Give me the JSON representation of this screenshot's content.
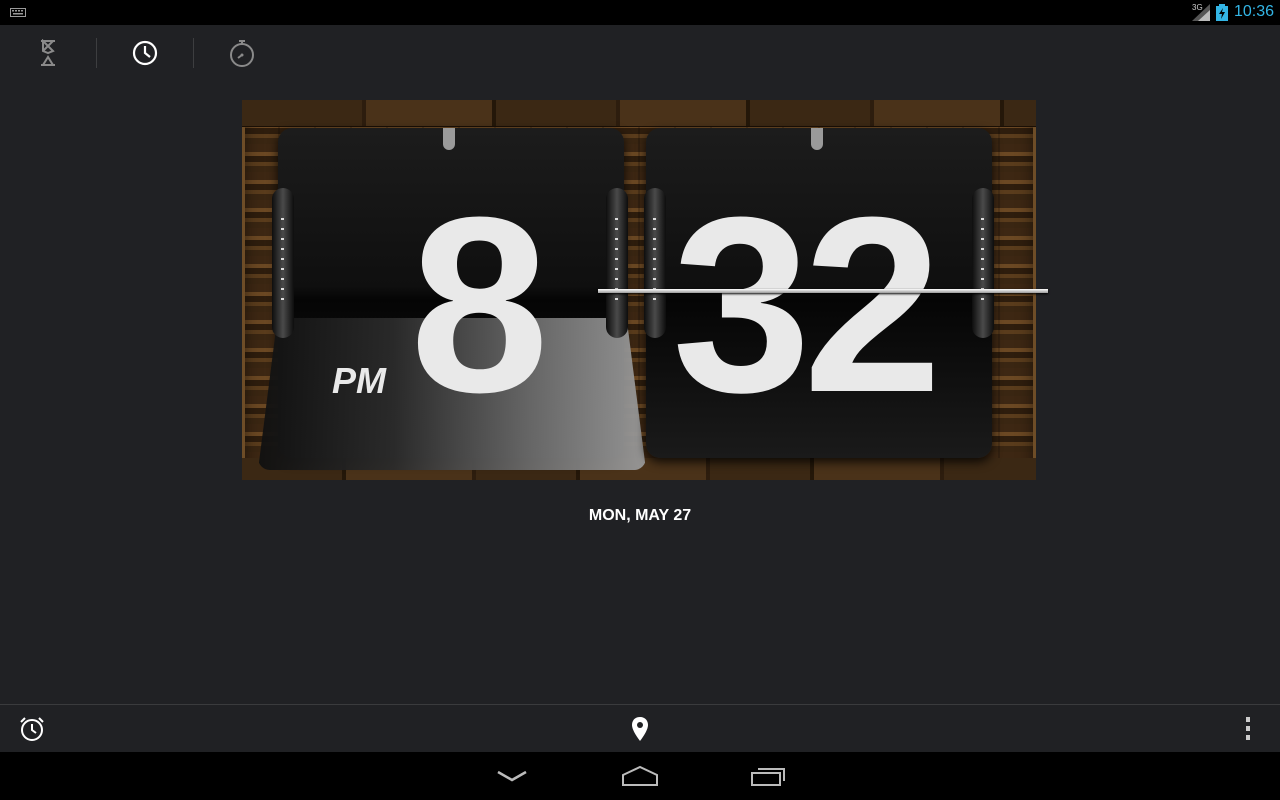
{
  "status_bar": {
    "time": "10:36",
    "network": "3G",
    "colors": {
      "time": "#33b5e5"
    }
  },
  "tabs": [
    {
      "name": "timer",
      "icon": "hourglass-icon",
      "selected": false
    },
    {
      "name": "clock",
      "icon": "clock-icon",
      "selected": true
    },
    {
      "name": "stopwatch",
      "icon": "stopwatch-icon",
      "selected": false
    }
  ],
  "clock_widget": {
    "hour": "8",
    "minutes": "32",
    "period": "PM"
  },
  "date": "MON, MAY 27",
  "action_bar": {
    "alarm_icon": "alarm-clock-icon",
    "cities_icon": "location-pin-icon",
    "menu_icon": "overflow-menu-icon"
  },
  "nav_bar": {
    "back_icon": "back-icon",
    "home_icon": "home-icon",
    "recents_icon": "recent-apps-icon"
  }
}
